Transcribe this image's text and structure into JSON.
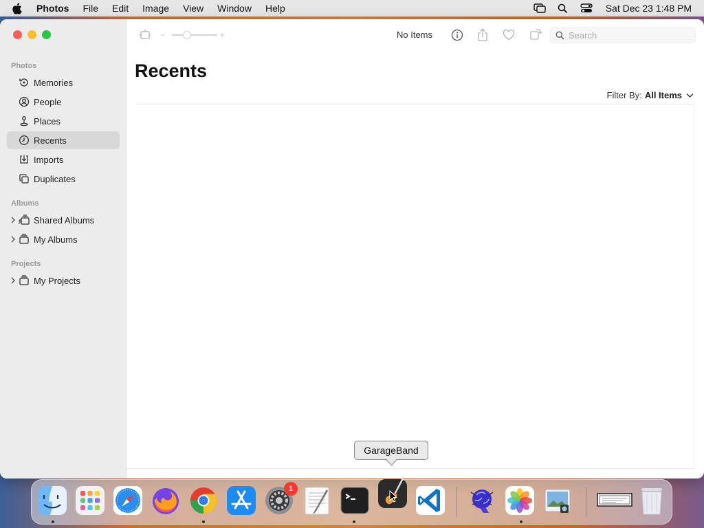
{
  "menubar": {
    "app_name": "Photos",
    "menus": [
      "File",
      "Edit",
      "Image",
      "View",
      "Window",
      "Help"
    ],
    "clock": "Sat Dec 23  1:48 PM"
  },
  "sidebar": {
    "sections": [
      {
        "title": "Photos"
      },
      {
        "title": "Albums"
      },
      {
        "title": "Projects"
      }
    ],
    "library_items": [
      {
        "label": "Memories",
        "icon": "memories-icon"
      },
      {
        "label": "People",
        "icon": "people-icon"
      },
      {
        "label": "Places",
        "icon": "places-icon"
      },
      {
        "label": "Recents",
        "icon": "clock-icon",
        "selected": true
      },
      {
        "label": "Imports",
        "icon": "imports-icon"
      },
      {
        "label": "Duplicates",
        "icon": "duplicates-icon"
      }
    ],
    "album_items": [
      {
        "label": "Shared Albums",
        "icon": "shared-albums-icon"
      },
      {
        "label": "My Albums",
        "icon": "albums-icon"
      }
    ],
    "project_items": [
      {
        "label": "My Projects",
        "icon": "projects-icon"
      }
    ]
  },
  "toolbar": {
    "status": "No Items",
    "search_placeholder": "Search"
  },
  "main": {
    "title": "Recents",
    "filter_label": "Filter By:",
    "filter_value": "All Items"
  },
  "tooltip": "GarageBand",
  "dock": {
    "apps": [
      "Finder",
      "Launchpad",
      "Safari",
      "Firefox",
      "Chrome",
      "App Store",
      "System Settings",
      "TextEdit",
      "Terminal",
      "GarageBand",
      "VS Code",
      "Automator",
      "Photos",
      "Preview",
      "Scanner",
      "Trash"
    ],
    "settings_badge": "1"
  },
  "colors": {
    "close": "#ff5f57",
    "minimize": "#febc2e",
    "zoom": "#28c840",
    "selection": "#d8d8d8"
  }
}
